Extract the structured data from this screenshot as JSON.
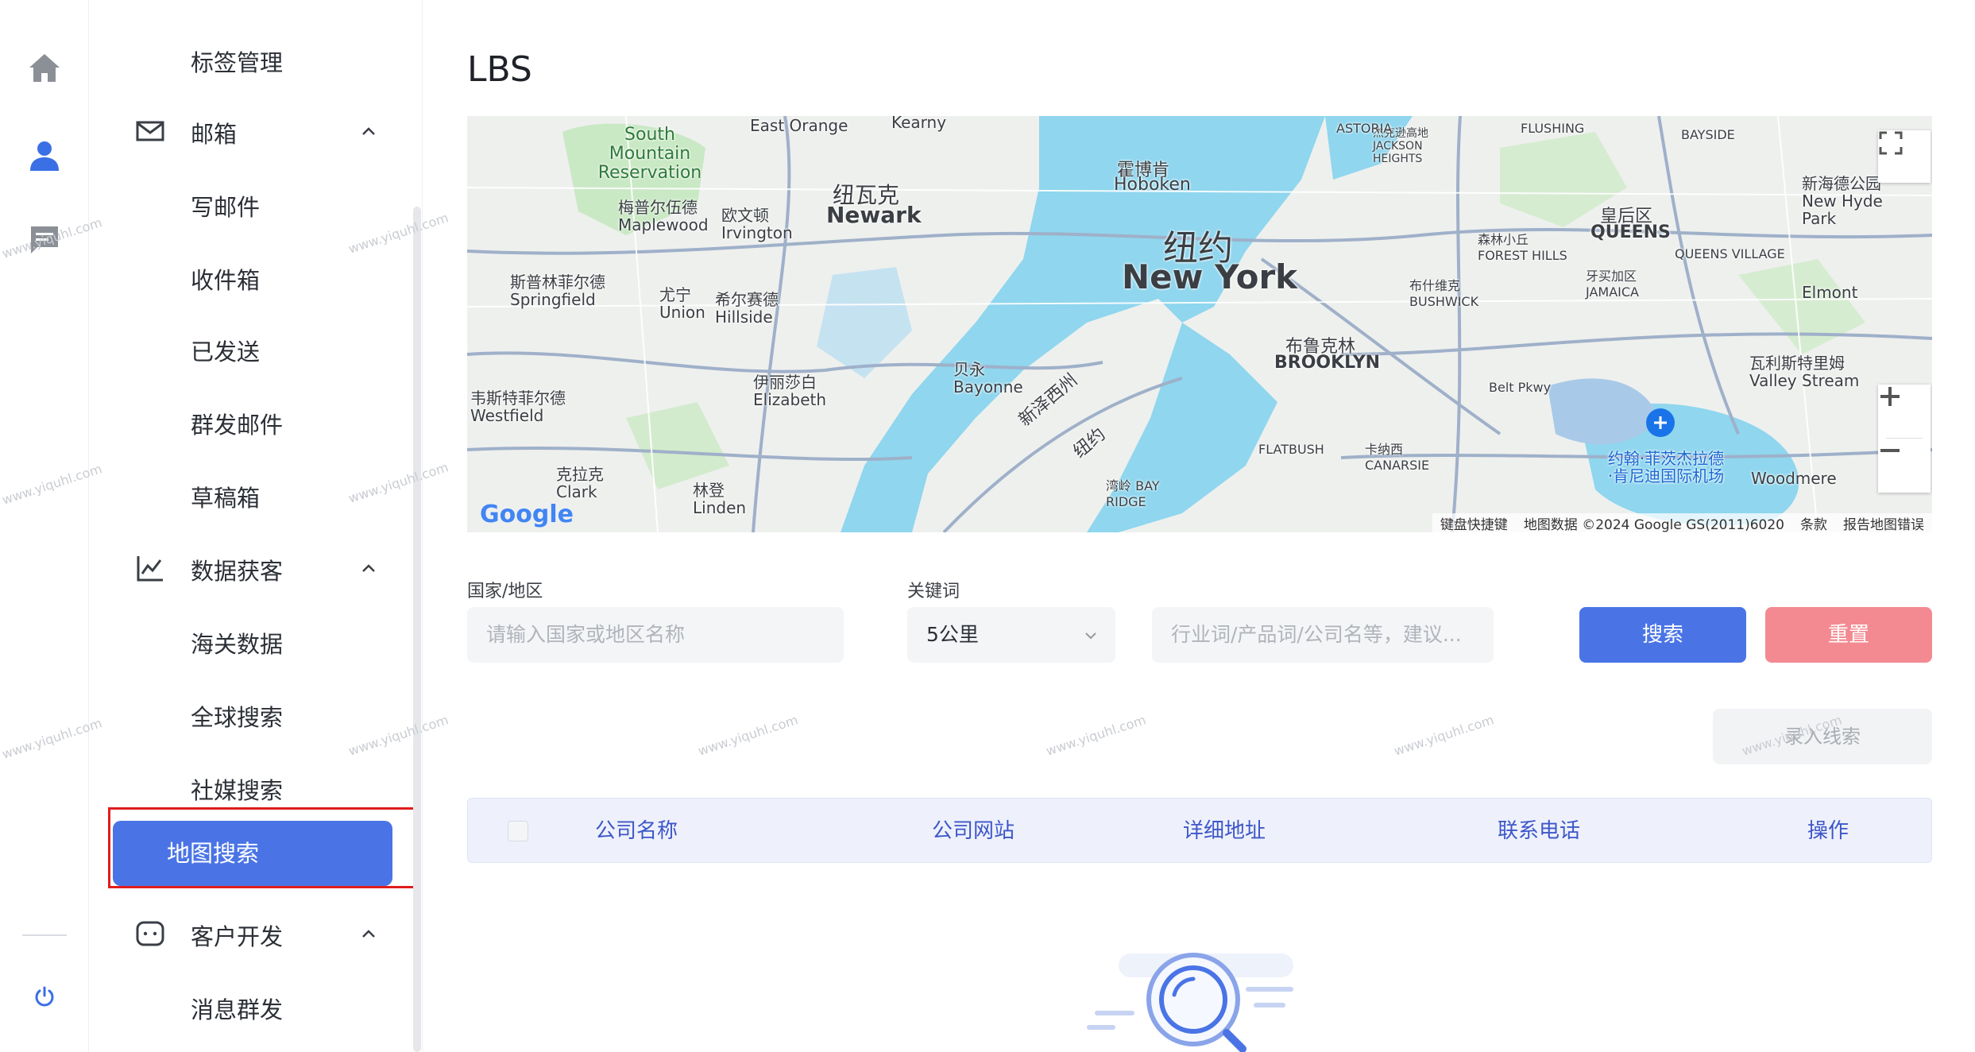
{
  "rail": {
    "icons": [
      "home-icon",
      "user-icon",
      "message-icon",
      "power-icon"
    ]
  },
  "sidebar": {
    "items": [
      {
        "label": "标签管理"
      },
      {
        "label": "邮箱"
      },
      {
        "label": "写邮件"
      },
      {
        "label": "收件箱"
      },
      {
        "label": "已发送"
      },
      {
        "label": "群发邮件"
      },
      {
        "label": "草稿箱"
      },
      {
        "label": "数据获客"
      },
      {
        "label": "海关数据"
      },
      {
        "label": "全球搜索"
      },
      {
        "label": "社媒搜索"
      },
      {
        "label": "地图搜索"
      },
      {
        "label": "客户开发"
      },
      {
        "label": "消息群发"
      }
    ]
  },
  "page": {
    "title": "LBS"
  },
  "map": {
    "labels": {
      "newyork_cn": "纽约",
      "newyork_en": "New York",
      "newark_cn": "纽瓦克",
      "newark_en": "Newark",
      "brooklyn_cn": "布鲁克林",
      "brooklyn_en": "BROOKLYN",
      "queens_cn": "皇后区",
      "queens_en": "QUEENS",
      "hoboken_cn": "霍博肯",
      "hoboken_en": "Hoboken",
      "south_mountain": "South Mountain Reservation",
      "east_orange": "East Orange",
      "kearny": "Kearny",
      "maplewood": "梅普尔伍德 Maplewood",
      "irvington": "欧文顿 Irvington",
      "springfield": "斯普林菲尔德 Springfield",
      "union": "尤宁 Union",
      "hillside": "希尔赛德 Hillside",
      "elizabeth": "伊丽莎白 Elizabeth",
      "westfield": "韦斯特菲尔德 Westfield",
      "bayonne": "贝永 Bayonne",
      "clark": "克拉克 Clark",
      "linden": "林登 Linden",
      "elmont": "Elmont",
      "valley_stream": "瓦利斯特里姆 Valley Stream",
      "woodmere": "Woodmere",
      "jfk": "约翰·菲茨杰拉德·肯尼迪国际机场",
      "jamaica": "牙买加区 JAMAICA",
      "canarsie": "卡纳西 CANARSIE",
      "flatbush": "FLATBUSH",
      "bay_ridge": "湾岭 BAY RIDGE",
      "bushwick": "布什维克 BUSHWICK",
      "forest_hills": "森林小丘 FOREST HILLS",
      "queens_village": "QUEENS VILLAGE",
      "new_hyde_park": "新海德公园 New Hyde Park",
      "jackson_heights": "杰克逊高地 JACKSON HEIGHTS",
      "flushing": "FLUSHING",
      "bayside": "BAYSIDE",
      "astoria": "ASTORIA",
      "new_jersey_west": "新泽西州",
      "newyork_state": "纽约",
      "belt_pkwy": "Belt Pkwy",
      "google": "Google"
    },
    "footer": {
      "shortcuts": "键盘快捷键",
      "data": "地图数据 ©2024 Google GS(2011)6020",
      "terms": "条款",
      "report": "报告地图错误"
    }
  },
  "form": {
    "country_label": "国家/地区",
    "country_placeholder": "请输入国家或地区名称",
    "keyword_label": "关键词",
    "radius_value": "5公里",
    "keyword_placeholder": "行业词/产品词/公司名等，建议...",
    "search_label": "搜索",
    "reset_label": "重置",
    "import_label": "录入线索"
  },
  "table": {
    "columns": [
      "公司名称",
      "公司网站",
      "详细地址",
      "联系电话",
      "操作"
    ]
  },
  "watermark": "www.yiquhl.com",
  "colors": {
    "primary": "#4a74e6",
    "danger": "#f38a92",
    "highlight_border": "#e01d1d",
    "water": "#8fd6ee"
  }
}
